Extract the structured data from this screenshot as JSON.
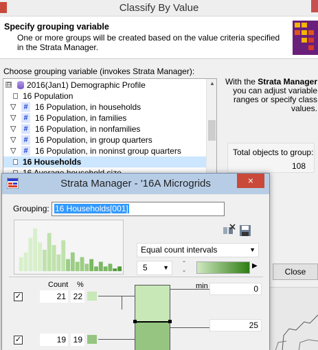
{
  "classify": {
    "title": "Classify By Value",
    "header_title": "Specify grouping variable",
    "header_desc": "One or more groups will be created based on the value criteria specified in the Strata Manager.",
    "choose_label": "Choose grouping variable (invokes Strata Manager):",
    "tree": [
      {
        "text": "2016(Jan1) Demographic Profile",
        "kind": "db",
        "expander": "⊟"
      },
      {
        "text": "16 Population",
        "kind": "leaf"
      },
      {
        "text": "16 Population, in households",
        "kind": "hash"
      },
      {
        "text": "16 Population, in families",
        "kind": "hash"
      },
      {
        "text": "16 Population, in nonfamilies",
        "kind": "hash"
      },
      {
        "text": "16 Population, in group quarters",
        "kind": "hash"
      },
      {
        "text": "16 Population, in noninst group quarters",
        "kind": "hash"
      },
      {
        "text": "16 Households",
        "kind": "leaf",
        "selected": true
      },
      {
        "text": "16 Average household size",
        "kind": "leaf"
      }
    ],
    "info_pre": "With the",
    "info_bold": "Strata Manager",
    "info_post": "you can adjust variable ranges or specify class values.",
    "total_label": "Total objects to group:",
    "total_value": "108",
    "close_label": "Close"
  },
  "strata": {
    "title": "Strata Manager - '16A Microgrids",
    "close_glyph": "×",
    "grouping_label": "Grouping:",
    "grouping_value": "16 Households[001]",
    "method": "Equal count intervals",
    "num_classes": "5",
    "col_count": "Count",
    "col_pct": "%",
    "col_min": "min",
    "rows": [
      {
        "count": "21",
        "pct": "22",
        "checked": "✓",
        "color": "#c8e8b8"
      },
      {
        "count": "19",
        "pct": "19",
        "checked": "✓",
        "color": "#95c581"
      }
    ],
    "min_value": "0",
    "break_value": "25",
    "histogram": [
      6,
      8,
      14,
      18,
      12,
      9,
      16,
      11,
      7,
      13,
      5,
      8,
      4,
      6,
      3,
      5,
      2,
      4,
      2,
      3,
      1,
      2
    ]
  },
  "colors": {
    "brand_green_light": "#c8e8b8",
    "brand_green_dark": "#2f7d12",
    "titlebar_blue": "#b7cde6",
    "close_red": "#c94a3a"
  }
}
